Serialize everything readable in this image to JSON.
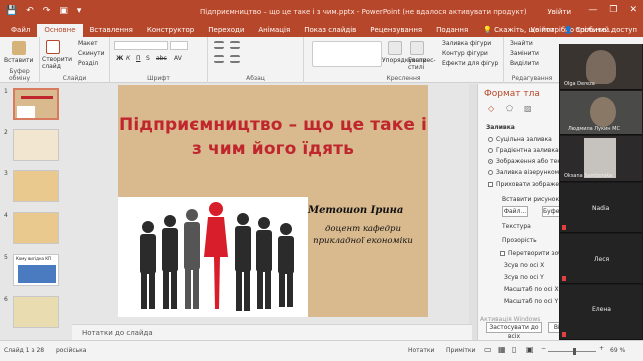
{
  "window": {
    "title": "Підприємництво – що це таке і з чим.pptx - PowerPoint (не вдалося активувати продукт)",
    "account": "Увійти",
    "minimize": "—",
    "restore": "❐",
    "close": "✕"
  },
  "qat": {
    "save": "💾",
    "undo": "↶",
    "redo": "↷",
    "present": "▣",
    "more": "▾"
  },
  "tabs": [
    "Файл",
    "Основне",
    "Вставлення",
    "Конструктор",
    "Переходи",
    "Анімація",
    "Показ слайдів",
    "Рецензування",
    "Подання"
  ],
  "active_tab_index": 1,
  "tell_me": "💡 Скажіть, що потрібно зробите...",
  "share": "Увійти",
  "share_button": "👤 Спільний доступ",
  "ribbon": {
    "clipboard": {
      "paste": "Вставити",
      "label": "Буфер обміну"
    },
    "slides": {
      "new_slide": "Створити слайд",
      "layout": "Макет",
      "reset": "Скинути",
      "section": "Розділ",
      "label": "Слайди"
    },
    "font": {
      "label": "Шрифт",
      "bold": "Ж",
      "italic": "К",
      "underline": "П",
      "shadow": "S",
      "strike": "abc",
      "spacing": "AV"
    },
    "paragraph": {
      "label": "Абзац"
    },
    "drawing": {
      "label": "Креслення",
      "arrange": "Упорядкувати",
      "quick_styles": "Експрес-стилі",
      "fill": "Заливка фігури",
      "outline": "Контур фігури",
      "effects": "Ефекти для фігур"
    },
    "editing": {
      "label": "Редагування",
      "find": "Знайти",
      "replace": "Замінити",
      "select": "Виділити"
    }
  },
  "thumbnails": {
    "numbers": [
      "1",
      "2",
      "3",
      "4",
      "5",
      "6"
    ],
    "selected_index": 0,
    "slide5_title": "Кому вигідна КП"
  },
  "slide": {
    "title": "Підприємництво – що це таке і з чим його їдять",
    "author": "Метошоп Ірина",
    "role": "доцент кафедри прикладної економіки"
  },
  "format_pane": {
    "title": "Формат тла",
    "section": "Заливка",
    "options": [
      {
        "label": "Суцільна заливка",
        "selected": false
      },
      {
        "label": "Градієнтна заливка",
        "selected": false
      },
      {
        "label": "Зображення або текстура",
        "selected": true
      },
      {
        "label": "Заливка візерунком",
        "selected": false
      }
    ],
    "hide_graphics": "Приховати зображення",
    "insert_picture": "Вставити рисунок з",
    "file_button": "Файл...",
    "clipboard_button": "Буфер",
    "texture": "Текстура",
    "transparency": "Прозорість",
    "tile": "Перетворити зображення",
    "offset_x": "Зсув по осі X",
    "offset_y": "Зсув по осі Y",
    "scale_x": "Масштаб по осі X",
    "scale_y": "Масштаб по осі Y",
    "apply_all": "Застосувати до всіх",
    "reset": "Відновити тло"
  },
  "participants": [
    {
      "name": "Olga Dereza"
    },
    {
      "name": "Людмила Лукин МС"
    },
    {
      "name": "Oksana Samborska"
    },
    {
      "name": "Nadia"
    },
    {
      "name": "Леся"
    },
    {
      "name": "Елена"
    }
  ],
  "watermark": "Активація Windows",
  "notes_placeholder": "Нотатки до слайда",
  "status": {
    "slide_counter": "Слайд 1 з 28",
    "language": "російська",
    "notes": "Нотатки",
    "comments": "Примітки",
    "zoom": "69 %",
    "zoom_fraction": 0.55
  },
  "colors": {
    "accent": "#b7472a",
    "title_red": "#c0262d",
    "slide_bg": "#d9b98e"
  }
}
